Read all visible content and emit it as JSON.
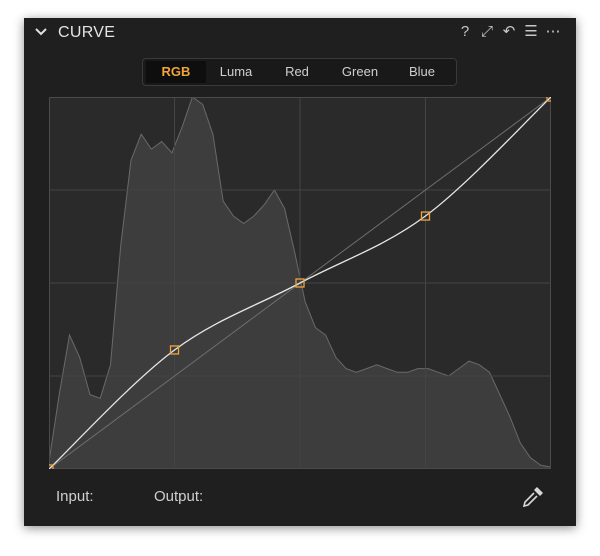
{
  "panel": {
    "title": "CURVE",
    "collapse_icon": "chevron-down-icon",
    "header_icons": [
      {
        "name": "help-icon",
        "glyph": "?"
      },
      {
        "name": "expand-icon",
        "glyph": "⤢"
      },
      {
        "name": "reset-icon",
        "glyph": "↶"
      },
      {
        "name": "menu-icon",
        "glyph": "☰"
      },
      {
        "name": "more-icon",
        "glyph": "⋯"
      }
    ]
  },
  "tabs": [
    {
      "label": "RGB",
      "active": true
    },
    {
      "label": "Luma",
      "active": false
    },
    {
      "label": "Red",
      "active": false
    },
    {
      "label": "Green",
      "active": false
    },
    {
      "label": "Blue",
      "active": false
    }
  ],
  "footer": {
    "input_label": "Input:",
    "output_label": "Output:",
    "eyedropper_icon": "eyedropper-icon"
  },
  "curve": {
    "control_points": [
      [
        0,
        0
      ],
      [
        0.25,
        0.32
      ],
      [
        0.5,
        0.5
      ],
      [
        0.75,
        0.68
      ],
      [
        1,
        1
      ]
    ]
  },
  "histogram": {
    "levels": [
      0.02,
      0.2,
      0.36,
      0.3,
      0.2,
      0.19,
      0.28,
      0.6,
      0.83,
      0.9,
      0.86,
      0.88,
      0.85,
      0.92,
      1.0,
      0.98,
      0.9,
      0.72,
      0.68,
      0.66,
      0.68,
      0.71,
      0.75,
      0.7,
      0.58,
      0.45,
      0.38,
      0.36,
      0.3,
      0.27,
      0.26,
      0.27,
      0.28,
      0.27,
      0.26,
      0.26,
      0.27,
      0.27,
      0.26,
      0.25,
      0.27,
      0.29,
      0.28,
      0.26,
      0.2,
      0.14,
      0.07,
      0.03,
      0.01,
      0.005
    ]
  },
  "colors": {
    "accent": "#f0a43a",
    "panel_bg": "#1f1f1f",
    "graph_bg": "#2a2a2a",
    "histogram_fill": "#3d3d3d",
    "curve": "#e6e6e6"
  }
}
